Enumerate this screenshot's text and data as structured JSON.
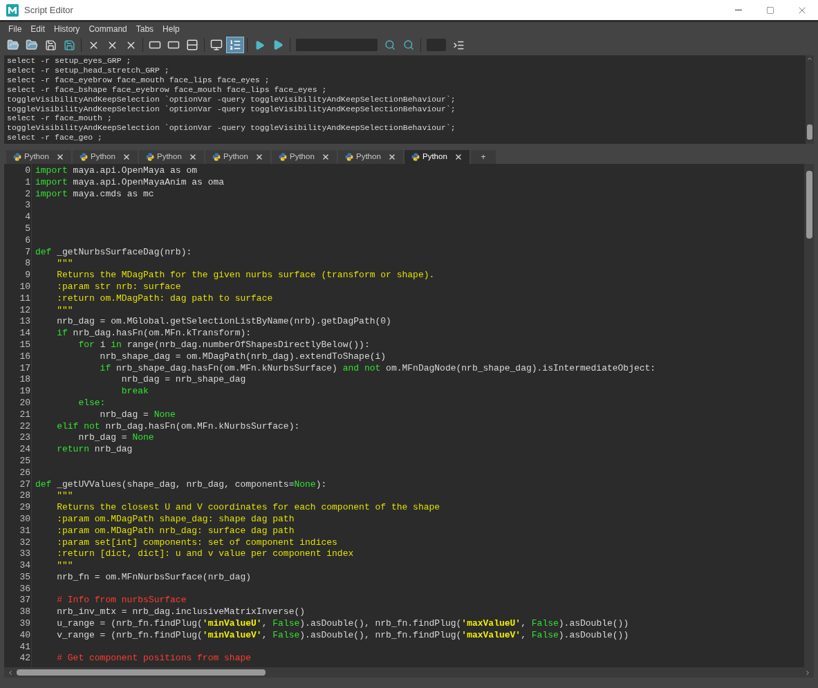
{
  "window": {
    "title": "Script Editor"
  },
  "menu": [
    "File",
    "Edit",
    "History",
    "Command",
    "Tabs",
    "Help"
  ],
  "toolbar": {
    "show_line_numbers": true
  },
  "history": [
    "select -r setup_eyes_GRP ;",
    "select -r setup_head_stretch_GRP ;",
    "select -r face_eyebrow face_mouth face_lips face_eyes ;",
    "select -r face_bshape face_eyebrow face_mouth face_lips face_eyes ;",
    "toggleVisibilityAndKeepSelection `optionVar -query toggleVisibilityAndKeepSelectionBehaviour`;",
    "toggleVisibilityAndKeepSelection `optionVar -query toggleVisibilityAndKeepSelectionBehaviour`;",
    "select -r face_mouth ;",
    "toggleVisibilityAndKeepSelection `optionVar -query toggleVisibilityAndKeepSelectionBehaviour`;",
    "select -r face_geo ;"
  ],
  "tabs": [
    {
      "label": "Python",
      "selected": false
    },
    {
      "label": "Python",
      "selected": false
    },
    {
      "label": "Python",
      "selected": false
    },
    {
      "label": "Python",
      "selected": false
    },
    {
      "label": "Python",
      "selected": false
    },
    {
      "label": "Python",
      "selected": false
    },
    {
      "label": "Python",
      "selected": true
    }
  ],
  "new_tab": "+",
  "code": [
    {
      "num": "0",
      "tokens": [
        {
          "kind": "kw",
          "text": "import"
        },
        {
          "kind": "plain",
          "text": " maya.api.OpenMaya as om"
        }
      ]
    },
    {
      "num": "1",
      "tokens": [
        {
          "kind": "kw",
          "text": "import"
        },
        {
          "kind": "plain",
          "text": " maya.api.OpenMayaAnim as oma"
        }
      ]
    },
    {
      "num": "2",
      "tokens": [
        {
          "kind": "kw",
          "text": "import"
        },
        {
          "kind": "plain",
          "text": " maya.cmds as mc"
        }
      ]
    },
    {
      "num": "3"
    },
    {
      "num": "4"
    },
    {
      "num": "5"
    },
    {
      "num": "6"
    },
    {
      "num": "7",
      "tokens": [
        {
          "kind": "kw",
          "text": "def"
        },
        {
          "kind": "plain",
          "text": " _getNurbsSurfaceDag(nrb):"
        }
      ]
    },
    {
      "num": "8",
      "tokens": [
        {
          "kind": "doc",
          "text": "    \"\"\""
        }
      ]
    },
    {
      "num": "9",
      "tokens": [
        {
          "kind": "doc",
          "text": "    Returns the MDagPath for the given nurbs surface (transform or shape)."
        }
      ]
    },
    {
      "num": "10",
      "tokens": [
        {
          "kind": "doc",
          "text": "    :param str nrb: surface"
        }
      ]
    },
    {
      "num": "11",
      "tokens": [
        {
          "kind": "doc",
          "text": "    :return om.MDagPath: dag path to surface"
        }
      ]
    },
    {
      "num": "12",
      "tokens": [
        {
          "kind": "doc",
          "text": "    \"\"\""
        }
      ]
    },
    {
      "num": "13",
      "tokens": [
        {
          "kind": "plain",
          "text": "    nrb_dag = om.MGlobal.getSelectionListByName(nrb).getDagPath(0)"
        }
      ]
    },
    {
      "num": "14",
      "tokens": [
        {
          "kind": "kw",
          "text": "    if"
        },
        {
          "kind": "plain",
          "text": " nrb_dag.hasFn(om.MFn.kTransform):"
        }
      ]
    },
    {
      "num": "15",
      "tokens": [
        {
          "kind": "kw",
          "text": "        for"
        },
        {
          "kind": "plain",
          "text": " i "
        },
        {
          "kind": "kw",
          "text": "in"
        },
        {
          "kind": "plain",
          "text": " range(nrb_dag.numberOfShapesDirectlyBelow()):"
        }
      ]
    },
    {
      "num": "16",
      "tokens": [
        {
          "kind": "plain",
          "text": "            nrb_shape_dag = om.MDagPath(nrb_dag).extendToShape(i)"
        }
      ]
    },
    {
      "num": "17",
      "tokens": [
        {
          "kind": "kw",
          "text": "            if"
        },
        {
          "kind": "plain",
          "text": " nrb_shape_dag.hasFn(om.MFn.kNurbsSurface) "
        },
        {
          "kind": "kw",
          "text": "and not"
        },
        {
          "kind": "plain",
          "text": " om.MFnDagNode(nrb_shape_dag).isIntermediateObject:"
        }
      ]
    },
    {
      "num": "18",
      "tokens": [
        {
          "kind": "plain",
          "text": "                nrb_dag = nrb_shape_dag"
        }
      ]
    },
    {
      "num": "19",
      "tokens": [
        {
          "kind": "kw",
          "text": "                break"
        }
      ]
    },
    {
      "num": "20",
      "tokens": [
        {
          "kind": "kw",
          "text": "        else:"
        }
      ]
    },
    {
      "num": "21",
      "tokens": [
        {
          "kind": "plain",
          "text": "            nrb_dag = "
        },
        {
          "kind": "kw",
          "text": "None"
        }
      ]
    },
    {
      "num": "22",
      "tokens": [
        {
          "kind": "kw",
          "text": "    elif not"
        },
        {
          "kind": "plain",
          "text": " nrb_dag.hasFn(om.MFn.kNurbsSurface):"
        }
      ]
    },
    {
      "num": "23",
      "tokens": [
        {
          "kind": "plain",
          "text": "        nrb_dag = "
        },
        {
          "kind": "kw",
          "text": "None"
        }
      ]
    },
    {
      "num": "24",
      "tokens": [
        {
          "kind": "kw",
          "text": "    return"
        },
        {
          "kind": "plain",
          "text": " nrb_dag"
        }
      ]
    },
    {
      "num": "25"
    },
    {
      "num": "26"
    },
    {
      "num": "27",
      "tokens": [
        {
          "kind": "kw",
          "text": "def"
        },
        {
          "kind": "plain",
          "text": " _getUVValues(shape_dag, nrb_dag, components="
        },
        {
          "kind": "kw",
          "text": "None"
        },
        {
          "kind": "plain",
          "text": "):"
        }
      ]
    },
    {
      "num": "28",
      "tokens": [
        {
          "kind": "doc",
          "text": "    \"\"\""
        }
      ]
    },
    {
      "num": "29",
      "tokens": [
        {
          "kind": "doc",
          "text": "    Returns the closest U and V coordinates for each component of the shape"
        }
      ]
    },
    {
      "num": "30",
      "tokens": [
        {
          "kind": "doc",
          "text": "    :param om.MDagPath shape_dag: shape dag path"
        }
      ]
    },
    {
      "num": "31",
      "tokens": [
        {
          "kind": "doc",
          "text": "    :param om.MDagPath nrb_dag: surface dag path"
        }
      ]
    },
    {
      "num": "32",
      "tokens": [
        {
          "kind": "doc",
          "text": "    :param set[int] components: set of component indices"
        }
      ]
    },
    {
      "num": "33",
      "tokens": [
        {
          "kind": "doc",
          "text": "    :return [dict, dict]: u and v value per component index"
        }
      ]
    },
    {
      "num": "34",
      "tokens": [
        {
          "kind": "doc",
          "text": "    \"\"\""
        }
      ]
    },
    {
      "num": "35",
      "tokens": [
        {
          "kind": "plain",
          "text": "    nrb_fn = om.MFnNurbsSurface(nrb_dag)"
        }
      ]
    },
    {
      "num": "36"
    },
    {
      "num": "37",
      "tokens": [
        {
          "kind": "comment",
          "text": "    # Info from nurbsSurface"
        }
      ]
    },
    {
      "num": "38",
      "tokens": [
        {
          "kind": "plain",
          "text": "    nrb_inv_mtx = nrb_dag.inclusiveMatrixInverse()"
        }
      ]
    },
    {
      "num": "39",
      "tokens": [
        {
          "kind": "plain",
          "text": "    u_range = (nrb_fn.findPlug("
        },
        {
          "kind": "str",
          "text": "'minValueU'"
        },
        {
          "kind": "plain",
          "text": ", "
        },
        {
          "kind": "kw",
          "text": "False"
        },
        {
          "kind": "plain",
          "text": ").asDouble(), nrb_fn.findPlug("
        },
        {
          "kind": "str",
          "text": "'maxValueU'"
        },
        {
          "kind": "plain",
          "text": ", "
        },
        {
          "kind": "kw",
          "text": "False"
        },
        {
          "kind": "plain",
          "text": ").asDouble())"
        }
      ]
    },
    {
      "num": "40",
      "tokens": [
        {
          "kind": "plain",
          "text": "    v_range = (nrb_fn.findPlug("
        },
        {
          "kind": "str",
          "text": "'minValueV'"
        },
        {
          "kind": "plain",
          "text": ", "
        },
        {
          "kind": "kw",
          "text": "False"
        },
        {
          "kind": "plain",
          "text": ").asDouble(), nrb_fn.findPlug("
        },
        {
          "kind": "str",
          "text": "'maxValueV'"
        },
        {
          "kind": "plain",
          "text": ", "
        },
        {
          "kind": "kw",
          "text": "False"
        },
        {
          "kind": "plain",
          "text": ").asDouble())"
        }
      ]
    },
    {
      "num": "41"
    },
    {
      "num": "42",
      "tokens": [
        {
          "kind": "comment",
          "text": "    # Get component positions from shape"
        }
      ]
    }
  ]
}
